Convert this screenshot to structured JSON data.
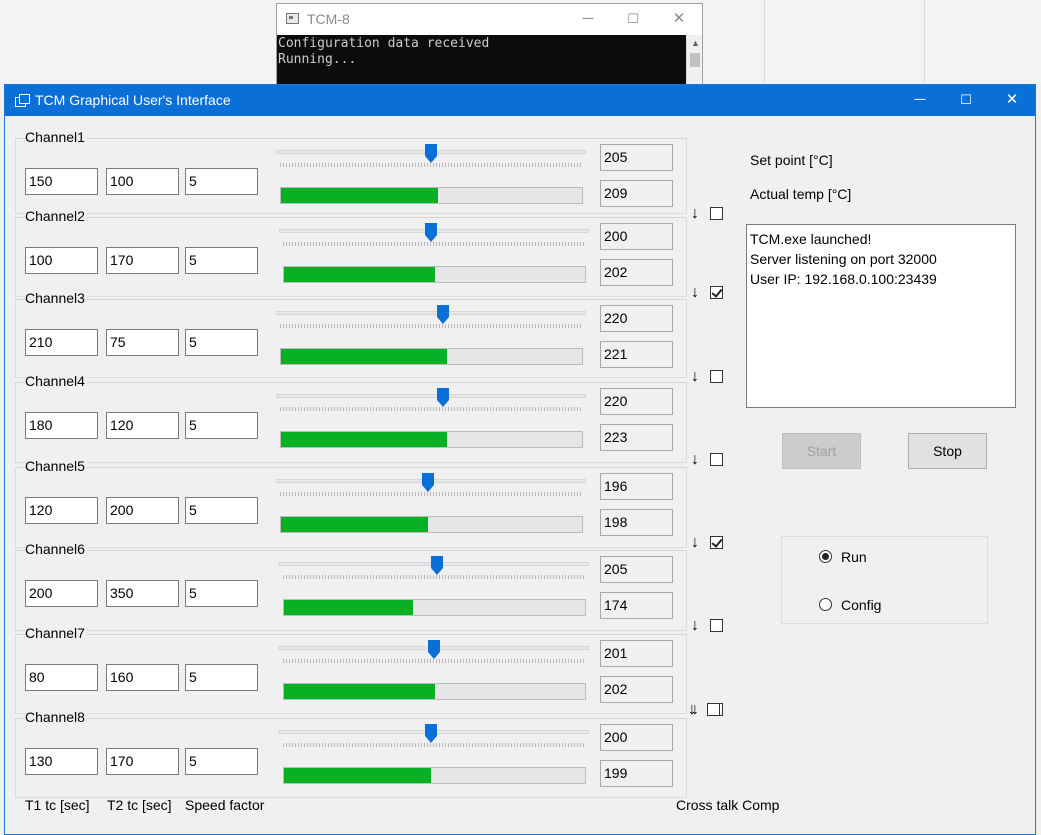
{
  "console": {
    "title": "TCM-8",
    "lines": [
      "Configuration data received",
      "Running..."
    ],
    "minimize": "─",
    "maximize": "☐",
    "close": "✕"
  },
  "window": {
    "title": "TCM Graphical User's Interface",
    "minimize": "─",
    "maximize": "☐",
    "close": "✕"
  },
  "channels": [
    {
      "label": "Channel1",
      "t1": "150",
      "t2": "100",
      "speed": "5",
      "setpoint": "205",
      "actual": "209",
      "slider_pct": 0.5,
      "progress_pct": 0.52,
      "crosstalk_checked": false
    },
    {
      "label": "Channel2",
      "t1": "100",
      "t2": "170",
      "speed": "5",
      "setpoint": "200",
      "actual": "202",
      "slider_pct": 0.49,
      "progress_pct": 0.5,
      "crosstalk_checked": true
    },
    {
      "label": "Channel3",
      "t1": "210",
      "t2": "75",
      "speed": "5",
      "setpoint": "220",
      "actual": "221",
      "slider_pct": 0.54,
      "progress_pct": 0.55,
      "crosstalk_checked": false
    },
    {
      "label": "Channel4",
      "t1": "180",
      "t2": "120",
      "speed": "5",
      "setpoint": "220",
      "actual": "223",
      "slider_pct": 0.54,
      "progress_pct": 0.55,
      "crosstalk_checked": false
    },
    {
      "label": "Channel5",
      "t1": "120",
      "t2": "200",
      "speed": "5",
      "setpoint": "196",
      "actual": "198",
      "slider_pct": 0.49,
      "progress_pct": 0.49,
      "crosstalk_checked": true
    },
    {
      "label": "Channel6",
      "t1": "200",
      "t2": "350",
      "speed": "5",
      "setpoint": "205",
      "actual": "174",
      "slider_pct": 0.51,
      "progress_pct": 0.43,
      "crosstalk_checked": false
    },
    {
      "label": "Channel7",
      "t1": "80",
      "t2": "160",
      "speed": "5",
      "setpoint": "201",
      "actual": "202",
      "slider_pct": 0.5,
      "progress_pct": 0.5,
      "crosstalk_checked": false
    },
    {
      "label": "Channel8",
      "t1": "130",
      "t2": "170",
      "speed": "5",
      "setpoint": "200",
      "actual": "199",
      "slider_pct": 0.49,
      "progress_pct": 0.49,
      "crosstalk_checked": null
    }
  ],
  "labels": {
    "setpoint": "Set point [°C]",
    "actual": "Actual temp [°C]",
    "t1": "T1 tc [sec]",
    "t2": "T2 tc [sec]",
    "speed": "Speed factor",
    "crosstalk": "Cross talk Comp"
  },
  "log": [
    "TCM.exe launched!",
    "Server listening on port 32000",
    "User IP: 192.168.0.100:23439"
  ],
  "buttons": {
    "start": "Start",
    "stop": "Stop"
  },
  "mode": {
    "run": "Run",
    "config": "Config",
    "selected": "run"
  },
  "arrow_glyph": "↓"
}
